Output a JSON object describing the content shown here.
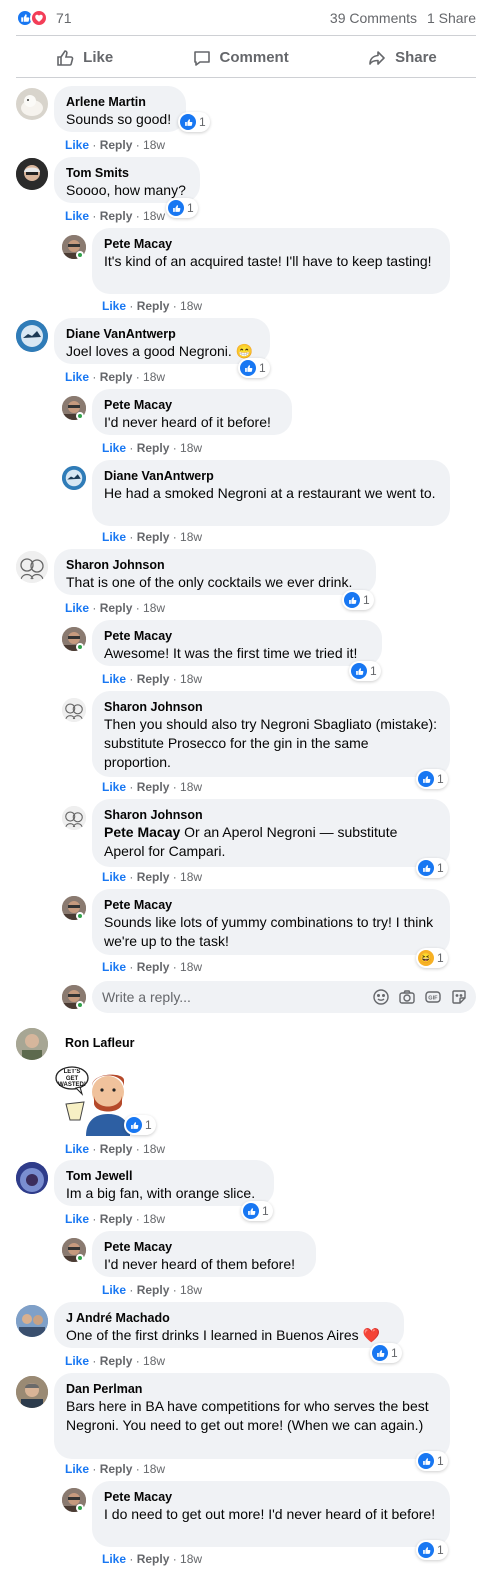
{
  "summary": {
    "reaction_count": "71",
    "comments": "39 Comments",
    "shares": "1 Share"
  },
  "actions": {
    "like": "Like",
    "comment": "Comment",
    "share": "Share"
  },
  "meta": {
    "like": "Like",
    "reply": "Reply",
    "time": "18w"
  },
  "comments": [
    {
      "author": "Arlene Martin",
      "text": "Sounds so good!",
      "reactions": "1"
    },
    {
      "author": "Tom Smits",
      "text": "Soooo, how many?",
      "reactions": "1"
    },
    {
      "author": "Pete Macay",
      "text": "It's kind of an acquired taste! I'll have to keep tasting!"
    },
    {
      "author": "Diane VanAntwerp",
      "text": "Joel loves a good Negroni. 😁",
      "reactions": "1"
    },
    {
      "author": "Pete Macay",
      "text": "I'd never heard of it before!"
    },
    {
      "author": "Diane VanAntwerp",
      "text": "He had a smoked Negroni at a restaurant we went to."
    },
    {
      "author": "Sharon Johnson",
      "text": "That is one of the only cocktails we ever drink.",
      "reactions": "1"
    },
    {
      "author": "Pete Macay",
      "text": "Awesome! It was the first time we tried it!",
      "reactions": "1"
    },
    {
      "author": "Sharon Johnson",
      "text": "Then you should also try Negroni Sbagliato (mistake): substitute Prosecco for the gin in the same proportion.",
      "reactions": "1"
    },
    {
      "author": "Sharon Johnson",
      "mention": "Pete Macay",
      "text": " Or an Aperol Negroni — substitute Aperol for Campari.",
      "reactions": "1"
    },
    {
      "author": "Pete Macay",
      "text": "Sounds like lots of yummy combinations to try! I think we're up to the task!",
      "reactions": "1"
    },
    {
      "author": "Ron Lafleur",
      "sticker_text": "LET'S GET WASTED!",
      "reactions": "1"
    },
    {
      "author": "Tom Jewell",
      "text": "Im a big fan, with orange slice.",
      "reactions": "1"
    },
    {
      "author": "Pete Macay",
      "text": "I'd never heard of them before!"
    },
    {
      "author": "J André Machado",
      "text": "One of the first drinks I learned in Buenos Aires ❤️",
      "reactions": "1"
    },
    {
      "author": "Dan Perlman",
      "text": "Bars here in BA have competitions for who serves the best Negroni. You need to get out more! (When we can again.)",
      "reactions": "1"
    },
    {
      "author": "Pete Macay",
      "text": "I do need to get out more! I'd never heard of it before!",
      "reactions": "1"
    }
  ],
  "reply_box": {
    "placeholder": "Write a reply..."
  },
  "icons": [
    "like-icon",
    "love-icon",
    "comment-icon",
    "share-icon",
    "emoji-icon",
    "camera-icon",
    "gif-icon",
    "sticker-icon"
  ]
}
